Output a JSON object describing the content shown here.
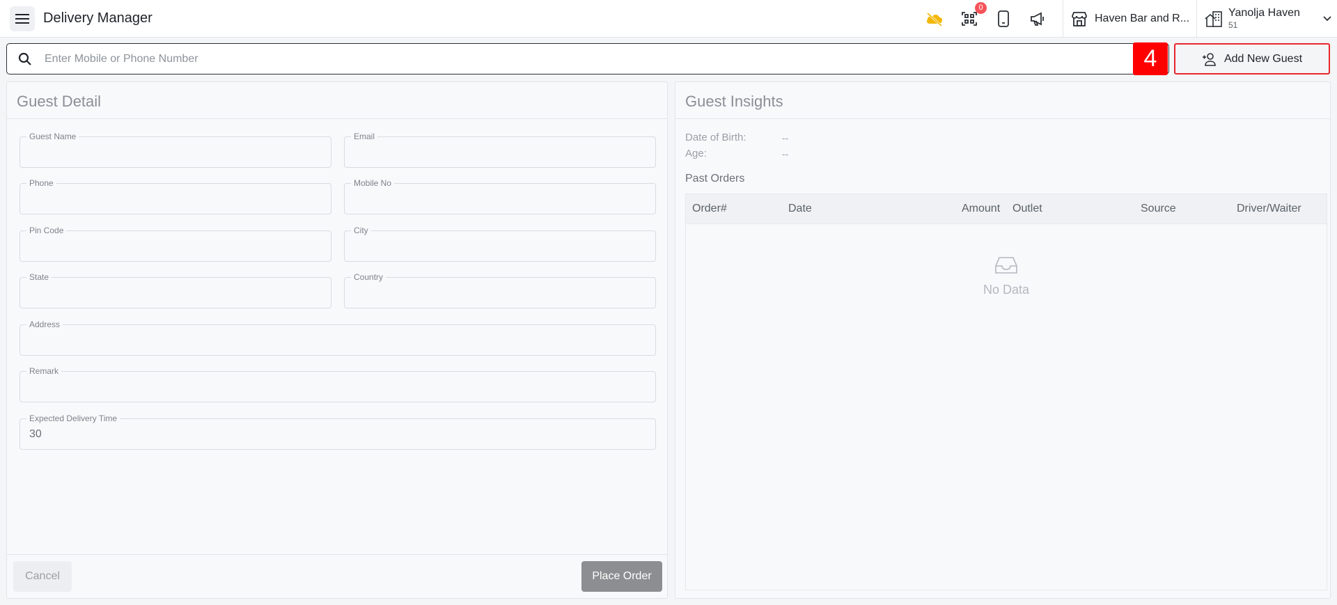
{
  "header": {
    "title": "Delivery Manager",
    "qr_badge": "0",
    "outlet_name": "Haven Bar and R...",
    "org_name": "Yanolja Haven",
    "org_sub": "51",
    "icons": [
      "menu-icon",
      "offline-cloud-icon",
      "qr-scan-icon",
      "mobile-icon",
      "megaphone-icon",
      "store-icon",
      "building-icon",
      "chevron-down-icon"
    ]
  },
  "search": {
    "placeholder": "Enter Mobile or Phone Number"
  },
  "step_marker": "4",
  "add_guest_label": "Add New Guest",
  "guest_detail": {
    "title": "Guest Detail",
    "fields": {
      "guest_name": "Guest Name",
      "email": "Email",
      "phone": "Phone",
      "mobile": "Mobile No",
      "pin_code": "Pin Code",
      "city": "City",
      "state": "State",
      "country": "Country",
      "address": "Address",
      "remark": "Remark",
      "delivery_time": "Expected Delivery Time"
    },
    "delivery_time_value": "30",
    "cancel_label": "Cancel",
    "place_order_label": "Place Order"
  },
  "guest_insights": {
    "title": "Guest Insights",
    "dob_label": "Date of Birth:",
    "dob_value": "--",
    "age_label": "Age:",
    "age_value": "--",
    "past_orders_title": "Past Orders",
    "columns": [
      "Order#",
      "Date",
      "Amount",
      "Outlet",
      "Source",
      "Driver/Waiter"
    ],
    "empty_text": "No Data"
  },
  "colors": {
    "accent_red": "#e8262d",
    "marker_red": "#ff0000",
    "badge_red": "#f5545a",
    "offline_icon": "#f2b705"
  }
}
